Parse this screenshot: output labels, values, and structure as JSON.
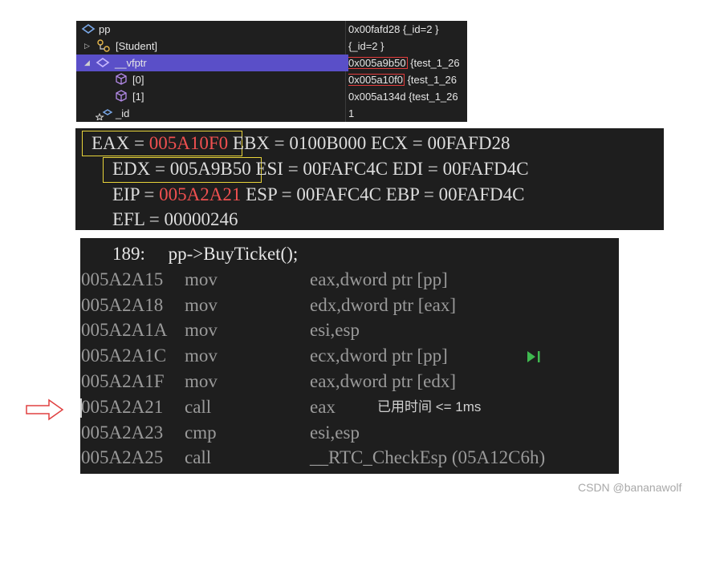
{
  "watch": {
    "rows": [
      {
        "name": "pp",
        "value": "0x00fafd28 {_id=2 }"
      },
      {
        "name": "[Student]",
        "value": "{_id=2 }"
      },
      {
        "name": "__vfptr",
        "value_addr": "0x005a9b50",
        "value_rest": " {test_1_26"
      },
      {
        "name": "[0]",
        "value_addr": "0x005a10f0",
        "value_rest": " {test_1_26"
      },
      {
        "name": "[1]",
        "value": "0x005a134d {test_1_26"
      },
      {
        "name": "_id",
        "value": "1"
      }
    ]
  },
  "registers": {
    "line1": {
      "eax_label": "EAX = ",
      "eax_value": "005A10F0",
      "rest": " EBX = 0100B000 ECX = 00FAFD28"
    },
    "line2": {
      "edx": "EDX = 005A9B50",
      "rest": " ESI = 00FAFC4C EDI = 00FAFD4C"
    },
    "line3": {
      "eip_label": "EIP = ",
      "eip_value": "005A2A21",
      "rest": " ESP = 00FAFC4C EBP = 00FAFD4C"
    },
    "line4": "EFL = 00000246"
  },
  "disassembly": {
    "source_line": "189:     pp->BuyTicket();",
    "rows": [
      {
        "addr": "005A2A15",
        "mnemonic": "mov",
        "operands": "eax,dword ptr [pp]"
      },
      {
        "addr": "005A2A18",
        "mnemonic": "mov",
        "operands": "edx,dword ptr [eax]"
      },
      {
        "addr": "005A2A1A",
        "mnemonic": "mov",
        "operands": "esi,esp"
      },
      {
        "addr": "005A2A1C",
        "mnemonic": "mov",
        "operands": "ecx,dword ptr [pp]"
      },
      {
        "addr": "005A2A1F",
        "mnemonic": "mov",
        "operands": "eax,dword ptr [edx]"
      },
      {
        "addr": "005A2A21",
        "mnemonic": "call",
        "operands": "eax"
      },
      {
        "addr": "005A2A23",
        "mnemonic": "cmp",
        "operands": "esi,esp"
      },
      {
        "addr": "005A2A25",
        "mnemonic": "call",
        "operands": "__RTC_CheckEsp (05A12C6h)"
      }
    ],
    "elapsed_hint": "已用时间 <= 1ms"
  },
  "watermark": "CSDN @bananawolf",
  "colors": {
    "accent_red": "#f05050",
    "highlight_box": "#e8d43a",
    "selection": "#5a4fc8"
  }
}
